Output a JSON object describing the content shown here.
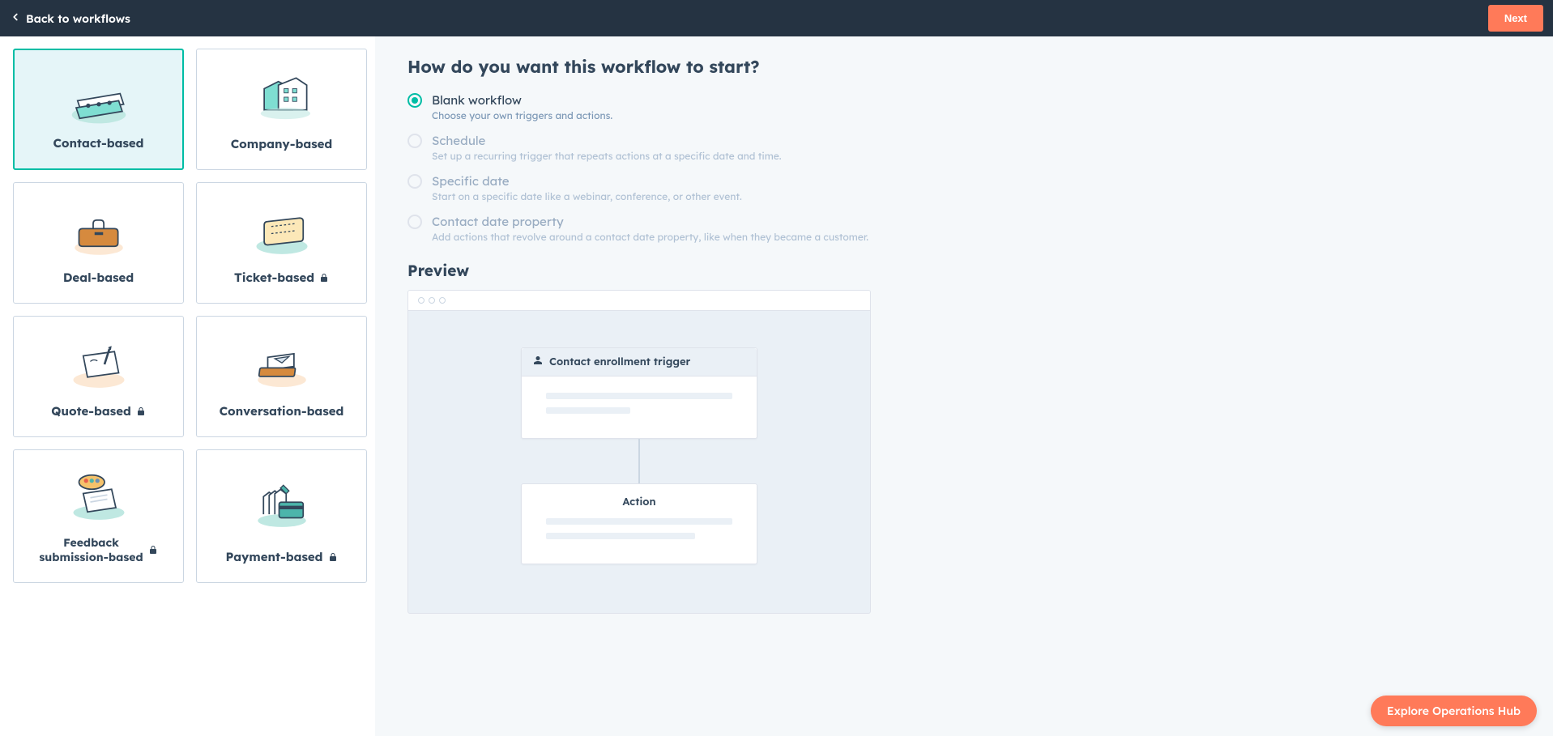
{
  "header": {
    "back_label": "Back to workflows",
    "next_label": "Next"
  },
  "cards": [
    {
      "id": "contact",
      "label": "Contact-based",
      "locked": false,
      "selected": true
    },
    {
      "id": "company",
      "label": "Company-based",
      "locked": false,
      "selected": false
    },
    {
      "id": "deal",
      "label": "Deal-based",
      "locked": false,
      "selected": false
    },
    {
      "id": "ticket",
      "label": "Ticket-based",
      "locked": true,
      "selected": false
    },
    {
      "id": "quote",
      "label": "Quote-based",
      "locked": true,
      "selected": false
    },
    {
      "id": "conversation",
      "label": "Conversation-based",
      "locked": false,
      "selected": false
    },
    {
      "id": "feedback",
      "label": "Feedback submission-based",
      "locked": true,
      "selected": false,
      "multiline": true
    },
    {
      "id": "payment",
      "label": "Payment-based",
      "locked": true,
      "selected": false
    }
  ],
  "question": "How do you want this workflow to start?",
  "start_options": [
    {
      "id": "blank",
      "title": "Blank workflow",
      "desc": "Choose your own triggers and actions.",
      "checked": true,
      "disabled": false
    },
    {
      "id": "schedule",
      "title": "Schedule",
      "desc": "Set up a recurring trigger that repeats actions at a specific date and time.",
      "checked": false,
      "disabled": true
    },
    {
      "id": "specific",
      "title": "Specific date",
      "desc": "Start on a specific date like a webinar, conference, or other event.",
      "checked": false,
      "disabled": true
    },
    {
      "id": "property",
      "title": "Contact date property",
      "desc": "Add actions that revolve around a contact date property, like when they became a customer.",
      "checked": false,
      "disabled": true
    }
  ],
  "preview_heading": "Preview",
  "preview": {
    "trigger_label": "Contact enrollment trigger",
    "action_label": "Action"
  },
  "fab_label": "Explore Operations Hub"
}
